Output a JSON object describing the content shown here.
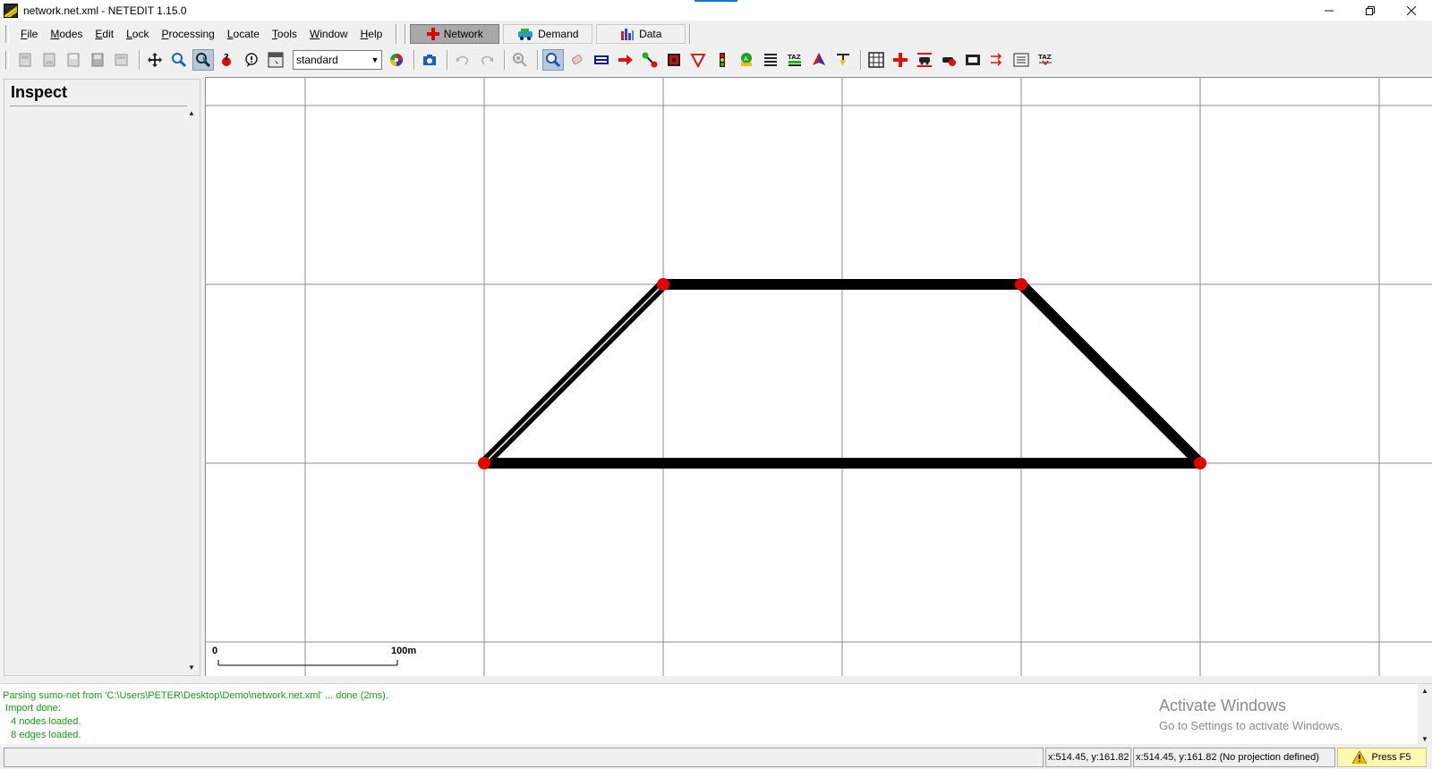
{
  "window": {
    "title": "network.net.xml - NETEDIT 1.15.0",
    "controls": [
      "minimize-icon",
      "restore-icon",
      "close-icon"
    ]
  },
  "menu": {
    "items": [
      "File",
      "Modes",
      "Edit",
      "Lock",
      "Processing",
      "Locate",
      "Tools",
      "Window",
      "Help"
    ],
    "supermodes": [
      {
        "label": "Network",
        "icon": "network-mode-icon",
        "active": true
      },
      {
        "label": "Demand",
        "icon": "demand-mode-icon",
        "active": false
      },
      {
        "label": "Data",
        "icon": "data-mode-icon",
        "active": false
      }
    ]
  },
  "toolbar": {
    "scheme": "standard",
    "file_icons": [
      "new-network-icon",
      "open-network-icon",
      "save-network-icon",
      "save-as-icon",
      "save-all-icon"
    ],
    "view_icons": [
      "recenter-view-icon",
      "zoom-icon",
      "locate-icon",
      "inspect-icon",
      "tooltip-icon",
      "menu-icon"
    ],
    "mode_icons": [
      "inspect-mode-icon",
      "delete-mode-icon",
      "select-mode-icon",
      "move-mode-icon",
      "create-edge-icon",
      "connection-icon",
      "prohibition-icon",
      "traffic-light-icon",
      "additional-icon",
      "crossing-icon",
      "taz-icon",
      "polygon-icon",
      "wire-icon"
    ],
    "toggle_icons": [
      "grid-icon",
      "junction-shape-icon",
      "vehicles-icon",
      "vehicle-route-icon",
      "select-all-icon",
      "edge-direction-icon",
      "lane-list-icon",
      "taz-settings-icon"
    ]
  },
  "left_panel": {
    "title": "Inspect"
  },
  "canvas": {
    "scale_start": "0",
    "scale_end": "100m",
    "network": {
      "nodes": 4,
      "edges": 8,
      "node_color": "#e00000",
      "edge_color": "#000000",
      "grid_color": "#8c8c8c"
    }
  },
  "messages": {
    "lines": [
      "Parsing sumo-net from 'C:\\Users\\PETER\\Desktop\\Demo\\network.net.xml' ... done (2ms).",
      " Import done:",
      "   4 nodes loaded.",
      "   8 edges loaded."
    ],
    "color": "#1a9a1a"
  },
  "watermark": {
    "title": "Activate Windows",
    "subtitle": "Go to Settings to activate Windows."
  },
  "status": {
    "coords1": "x:514.45, y:161.82",
    "coords2": "x:514.45, y:161.82 (No projection defined)",
    "hint": "Press F5"
  }
}
